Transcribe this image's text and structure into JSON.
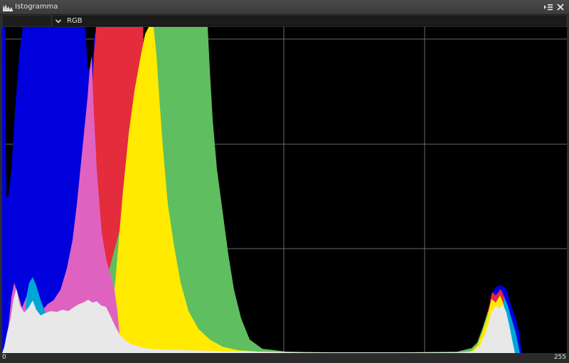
{
  "panel": {
    "title": "Istogramma",
    "icon": "histogram-icon",
    "menu_icon": "panel-menu-icon",
    "close_icon": "close-icon"
  },
  "toolbar": {
    "dropdown_icon": "chevron-down-icon",
    "channel_mode": "RGB"
  },
  "histogram": {
    "x_min_label": "0",
    "x_max_label": "255",
    "grid": true,
    "colors": {
      "background": "#000000",
      "grid": "#8a8a8a",
      "blue": "#0000dd",
      "red": "#e42c3c",
      "green": "#5fbe5f",
      "yellow": "#ffea00",
      "magenta": "#e062c0",
      "cyan": "#00a6d8",
      "white": "#e8e8e8"
    }
  }
}
